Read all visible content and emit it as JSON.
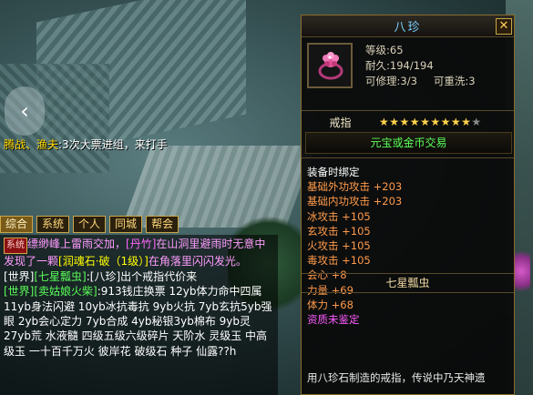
{
  "scene": {
    "back_glyph": "‹"
  },
  "top_chat": {
    "name": "腾战、渔夫",
    "text": ":3次大票进组，来打手"
  },
  "chat_tabs": [
    "综合",
    "系统",
    "个人",
    "同城",
    "帮会"
  ],
  "chat_lines": [
    {
      "prefix": "系统",
      "parts": [
        {
          "c": "c-pink",
          "t": "缥缈峰上雷雨交加，"
        },
        {
          "c": "c-mag",
          "t": "[丹竹]"
        },
        {
          "c": "c-pink",
          "t": "在山洞里避雨时无意中发现了一颗"
        },
        {
          "c": "c-ylw",
          "t": "[润魂石·破（1级）]"
        },
        {
          "c": "c-pink",
          "t": "在角落里闪闪发光。"
        }
      ]
    },
    {
      "parts": [
        {
          "c": "c-wht",
          "t": "[世界]"
        },
        {
          "c": "c-grn",
          "t": "[七星瓢虫]"
        },
        {
          "c": "c-wht",
          "t": ":"
        },
        {
          "c": "c-wht",
          "t": "[八珍]"
        },
        {
          "c": "c-wht",
          "t": "出个戒指代价来"
        }
      ]
    },
    {
      "parts": [
        {
          "c": "c-grn",
          "t": "[世界][卖姑娘火柴]"
        },
        {
          "c": "c-wht",
          "t": ":913钱庄换票  12yb体力命中四属  11yb身法闪避  10yb冰抗毒抗  9yb火抗  7yb玄抗5yb强眼  2yb会心定力  7yb合成  4yb秘银3yb棉布  9yb灵27yb荒 水液髓  四级五级六级碎片  天阶水 灵级玉 中高级玉 一十百千万火 彼岸花 破级石 种子 仙露??h"
        }
      ]
    }
  ],
  "item": {
    "title": "八珍",
    "close": "✕",
    "level": "等级:65",
    "durability": "耐久:194/194",
    "repair": "可修理:3/3",
    "rewash": "可重洗:3",
    "category": "戒指",
    "stars_on": 9,
    "stars_total": 10,
    "trade": "元宝或金币交易",
    "bind": "装备时绑定",
    "attributes": [
      "基础外功攻击 +203",
      "基础内功攻击 +203",
      "冰攻击 +105",
      "玄攻击 +105",
      "火攻击 +105",
      "毒攻击 +105",
      "会心 +8",
      "力量 +69",
      "体力 +68"
    ],
    "unidentified": "资质未鉴定",
    "maker": "七星瓢虫",
    "description": "用八珍石制造的戒指，传说中乃天神遗"
  }
}
